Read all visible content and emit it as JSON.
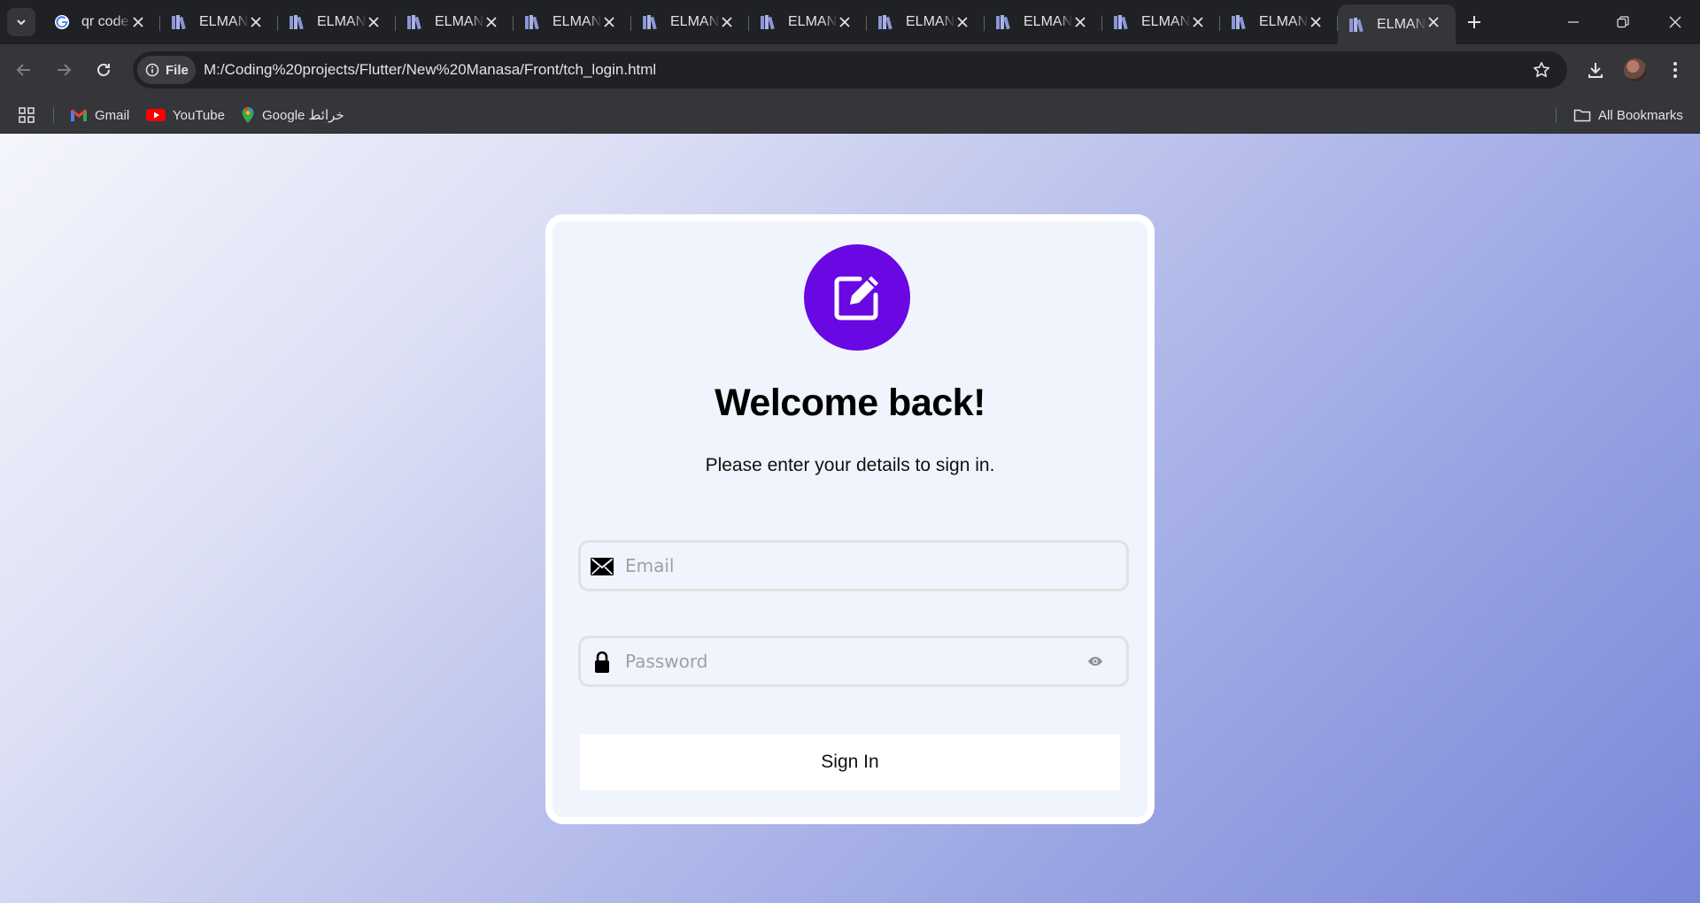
{
  "browser": {
    "tabs": [
      {
        "title": "qr code",
        "favicon": "google-icon",
        "active": false
      },
      {
        "title": "ELMANASA",
        "favicon": "books-icon",
        "active": false
      },
      {
        "title": "ELMANASA",
        "favicon": "books-icon",
        "active": false
      },
      {
        "title": "ELMANASA",
        "favicon": "books-icon",
        "active": false
      },
      {
        "title": "ELMANASA",
        "favicon": "books-icon",
        "active": false
      },
      {
        "title": "ELMANASA",
        "favicon": "books-icon",
        "active": false
      },
      {
        "title": "ELMANASA",
        "favicon": "books-icon",
        "active": false
      },
      {
        "title": "ELMANASA",
        "favicon": "books-icon",
        "active": false
      },
      {
        "title": "ELMANASA",
        "favicon": "books-icon",
        "active": false
      },
      {
        "title": "ELMANASA",
        "favicon": "books-icon",
        "active": false
      },
      {
        "title": "ELMANASA",
        "favicon": "books-icon",
        "active": false
      },
      {
        "title": "ELMANASA",
        "favicon": "books-icon",
        "active": true
      }
    ],
    "address": {
      "chip_label": "File",
      "url": "M:/Coding%20projects/Flutter/New%20Manasa/Front/tch_login.html"
    },
    "bookmarks": [
      {
        "label": "Gmail",
        "icon": "gmail-icon"
      },
      {
        "label": "YouTube",
        "icon": "youtube-icon"
      },
      {
        "label": "Google خرائط",
        "icon": "maps-icon"
      }
    ],
    "all_bookmarks_label": "All Bookmarks"
  },
  "login": {
    "logo_icon": "edit-icon",
    "title": "Welcome back!",
    "subtitle": "Please enter your details to sign in.",
    "email_placeholder": "Email",
    "password_placeholder": "Password",
    "submit_label": "Sign In"
  },
  "colors": {
    "accent": "#6a08e3",
    "card_bg": "#f0f4fd",
    "gradient_start": "#f4f5fc",
    "gradient_end": "#7a87d9"
  }
}
